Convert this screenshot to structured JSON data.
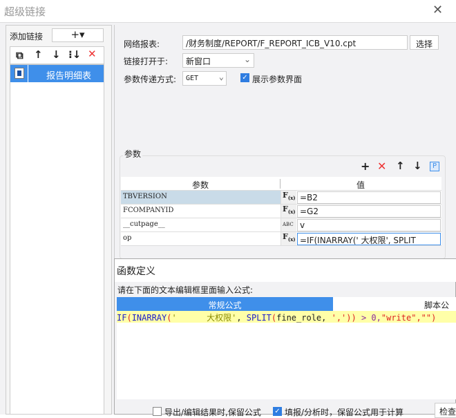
{
  "dialog": {
    "title": "超级链接"
  },
  "left": {
    "add_link_label": "添加链接",
    "add_button": "+▾",
    "links": [
      {
        "label": "报告明细表"
      }
    ]
  },
  "right": {
    "report_label": "网络报表:",
    "report_value": "/财务制度/REPORT/F_REPORT_ICB_V10.cpt",
    "select_button": "选择",
    "open_label": "链接打开于:",
    "open_value": "新窗口",
    "method_label": "参数传递方式:",
    "method_value": "GET",
    "show_params_label": "展示参数界面",
    "show_params_checked": true,
    "params_group": "参数",
    "col_param": "参数",
    "col_value": "值",
    "params": [
      {
        "name": "TBVERSION",
        "type": "F(x)",
        "value": "=B2"
      },
      {
        "name": "FCOMPANYID",
        "type": "F(x)",
        "value": "=G2"
      },
      {
        "name": "__cutpage__",
        "type": "ABC",
        "value": "v"
      },
      {
        "name": "op",
        "type": "F(x)",
        "value": "=IF(INARRAY('      大权限', SPLIT"
      }
    ]
  },
  "function_dialog": {
    "title": "函数定义",
    "prompt": "请在下面的文本编辑框里面输入公式:",
    "tab_normal": "常规公式",
    "tab_script": "脚本公式",
    "formula": {
      "fn1": "IF",
      "p1": "(",
      "fn2": "INARRAY",
      "p2": "(",
      "str1": "'      大权限'",
      "c1": ", ",
      "fn3": "SPLIT",
      "p3": "(",
      "arg": "fine_role, ",
      "str2": "','",
      "p4": "))",
      "op": " > 0,",
      "str3": "\"write\",\"\"",
      "p5": ")"
    },
    "export_keep_label": "导出/编辑结果时,保留公式",
    "export_keep_checked": false,
    "fill_keep_label": "填报/分析时，保留公式用于计算",
    "fill_keep_checked": true,
    "check_button": "检查"
  },
  "colors": {
    "accent": "#3f8fea",
    "formula_bg": "#ffffa8"
  }
}
